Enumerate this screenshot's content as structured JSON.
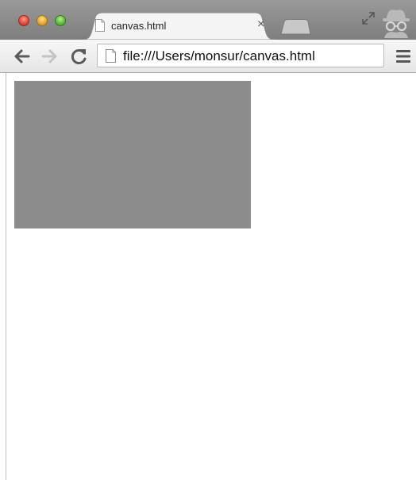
{
  "tab": {
    "title": "canvas.html",
    "close_glyph": "×",
    "icon": "page-icon"
  },
  "toolbar": {
    "back_icon": "back-arrow-icon",
    "forward_icon": "forward-arrow-icon",
    "reload_icon": "reload-icon",
    "menu_icon": "hamburger-menu-icon"
  },
  "omnibox": {
    "url": "file:///Users/monsur/canvas.html",
    "icon": "page-icon"
  },
  "colors": {
    "canvas_fill": "#8c8c8c",
    "tab_active": "#f4f4f4",
    "toolbar_bg": "#ededed"
  }
}
